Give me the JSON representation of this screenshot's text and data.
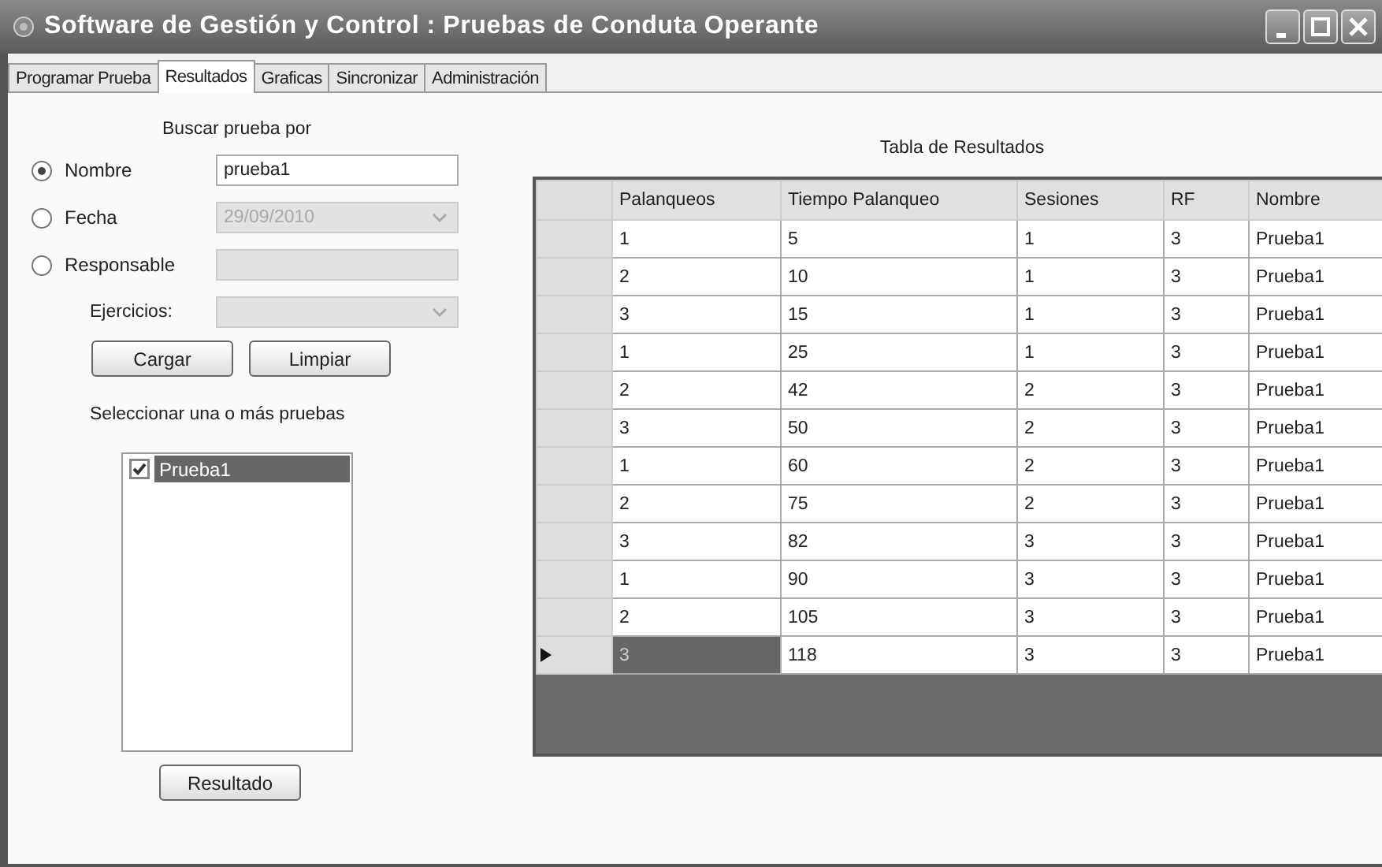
{
  "window": {
    "title": "Software de Gestión y Control : Pruebas de Conduta Operante"
  },
  "tabs": [
    {
      "label": "Programar Prueba",
      "selected": false
    },
    {
      "label": "Resultados",
      "selected": true
    },
    {
      "label": "Graficas",
      "selected": false
    },
    {
      "label": "Sincronizar",
      "selected": false
    },
    {
      "label": "Administración",
      "selected": false
    }
  ],
  "search": {
    "heading": "Buscar prueba por",
    "options": [
      {
        "label": "Nombre",
        "selected": true,
        "kind": "text",
        "value": "prueba1",
        "disabled": false
      },
      {
        "label": "Fecha",
        "selected": false,
        "kind": "dropdown",
        "value": "29/09/2010",
        "disabled": true
      },
      {
        "label": "Responsable",
        "selected": false,
        "kind": "text",
        "disabled": true
      }
    ],
    "exercises": {
      "label": "Ejercicios:",
      "disabled": true
    },
    "buttons": [
      "Cargar",
      "Limpiar"
    ]
  },
  "tests": {
    "label": "Seleccionar una o más pruebas",
    "items": [
      {
        "label": "Prueba1",
        "checked": true,
        "selected": true
      }
    ],
    "button": "Resultado"
  },
  "table": {
    "title": "Tabla de Resultados",
    "columns": [
      "Palanqueos",
      "Tiempo Palanqueo",
      "Sesiones",
      "RF",
      "Nombre"
    ],
    "rows": [
      {
        "current": false,
        "cells": [
          {
            "text": "1",
            "selected": false
          },
          {
            "text": "5",
            "selected": false
          },
          {
            "text": "1",
            "selected": false
          },
          {
            "text": "3",
            "selected": false
          },
          {
            "text": "Prueba1",
            "selected": false
          }
        ]
      },
      {
        "current": false,
        "cells": [
          {
            "text": "2",
            "selected": false
          },
          {
            "text": "10",
            "selected": false
          },
          {
            "text": "1",
            "selected": false
          },
          {
            "text": "3",
            "selected": false
          },
          {
            "text": "Prueba1",
            "selected": false
          }
        ]
      },
      {
        "current": false,
        "cells": [
          {
            "text": "3",
            "selected": false
          },
          {
            "text": "15",
            "selected": false
          },
          {
            "text": "1",
            "selected": false
          },
          {
            "text": "3",
            "selected": false
          },
          {
            "text": "Prueba1",
            "selected": false
          }
        ]
      },
      {
        "current": false,
        "cells": [
          {
            "text": "1",
            "selected": false
          },
          {
            "text": "25",
            "selected": false
          },
          {
            "text": "1",
            "selected": false
          },
          {
            "text": "3",
            "selected": false
          },
          {
            "text": "Prueba1",
            "selected": false
          }
        ]
      },
      {
        "current": false,
        "cells": [
          {
            "text": "2",
            "selected": false
          },
          {
            "text": "42",
            "selected": false
          },
          {
            "text": "2",
            "selected": false
          },
          {
            "text": "3",
            "selected": false
          },
          {
            "text": "Prueba1",
            "selected": false
          }
        ]
      },
      {
        "current": false,
        "cells": [
          {
            "text": "3",
            "selected": false
          },
          {
            "text": "50",
            "selected": false
          },
          {
            "text": "2",
            "selected": false
          },
          {
            "text": "3",
            "selected": false
          },
          {
            "text": "Prueba1",
            "selected": false
          }
        ]
      },
      {
        "current": false,
        "cells": [
          {
            "text": "1",
            "selected": false
          },
          {
            "text": "60",
            "selected": false
          },
          {
            "text": "2",
            "selected": false
          },
          {
            "text": "3",
            "selected": false
          },
          {
            "text": "Prueba1",
            "selected": false
          }
        ]
      },
      {
        "current": false,
        "cells": [
          {
            "text": "2",
            "selected": false
          },
          {
            "text": "75",
            "selected": false
          },
          {
            "text": "2",
            "selected": false
          },
          {
            "text": "3",
            "selected": false
          },
          {
            "text": "Prueba1",
            "selected": false
          }
        ]
      },
      {
        "current": false,
        "cells": [
          {
            "text": "3",
            "selected": false
          },
          {
            "text": "82",
            "selected": false
          },
          {
            "text": "3",
            "selected": false
          },
          {
            "text": "3",
            "selected": false
          },
          {
            "text": "Prueba1",
            "selected": false
          }
        ]
      },
      {
        "current": false,
        "cells": [
          {
            "text": "1",
            "selected": false
          },
          {
            "text": "90",
            "selected": false
          },
          {
            "text": "3",
            "selected": false
          },
          {
            "text": "3",
            "selected": false
          },
          {
            "text": "Prueba1",
            "selected": false
          }
        ]
      },
      {
        "current": false,
        "cells": [
          {
            "text": "2",
            "selected": false
          },
          {
            "text": "105",
            "selected": false
          },
          {
            "text": "3",
            "selected": false
          },
          {
            "text": "3",
            "selected": false
          },
          {
            "text": "Prueba1",
            "selected": false
          }
        ]
      },
      {
        "current": true,
        "cells": [
          {
            "text": "3",
            "selected": true
          },
          {
            "text": "118",
            "selected": false
          },
          {
            "text": "3",
            "selected": false
          },
          {
            "text": "3",
            "selected": false
          },
          {
            "text": "Prueba1",
            "selected": false
          }
        ]
      }
    ]
  }
}
